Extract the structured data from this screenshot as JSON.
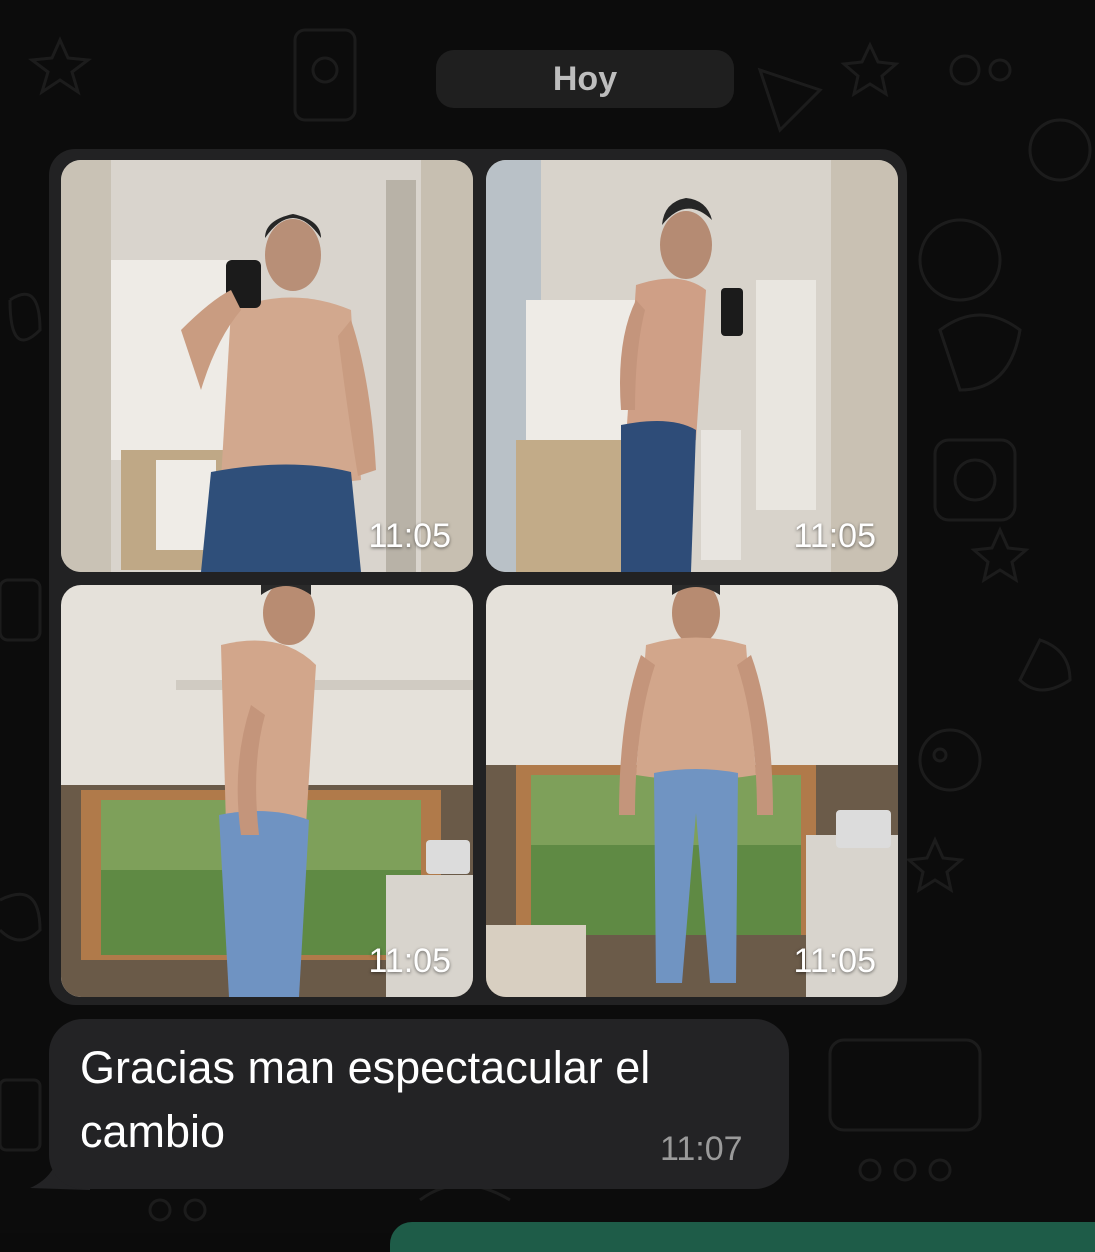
{
  "chat": {
    "date_separator": "Hoy",
    "album": {
      "photos": [
        {
          "icon": "mirror-selfie-front-photo",
          "time": "11:05"
        },
        {
          "icon": "mirror-selfie-side-photo",
          "time": "11:05"
        },
        {
          "icon": "side-profile-photo",
          "time": "11:05"
        },
        {
          "icon": "front-standing-photo",
          "time": "11:05"
        }
      ]
    },
    "message": {
      "text": "Gracias man espectacular el cambio",
      "time": "11:07"
    }
  },
  "colors": {
    "background": "#0c0c0c",
    "bubble": "#232325",
    "date_pill": "#1f1f1f",
    "accent_strip": "#1e5c48"
  }
}
